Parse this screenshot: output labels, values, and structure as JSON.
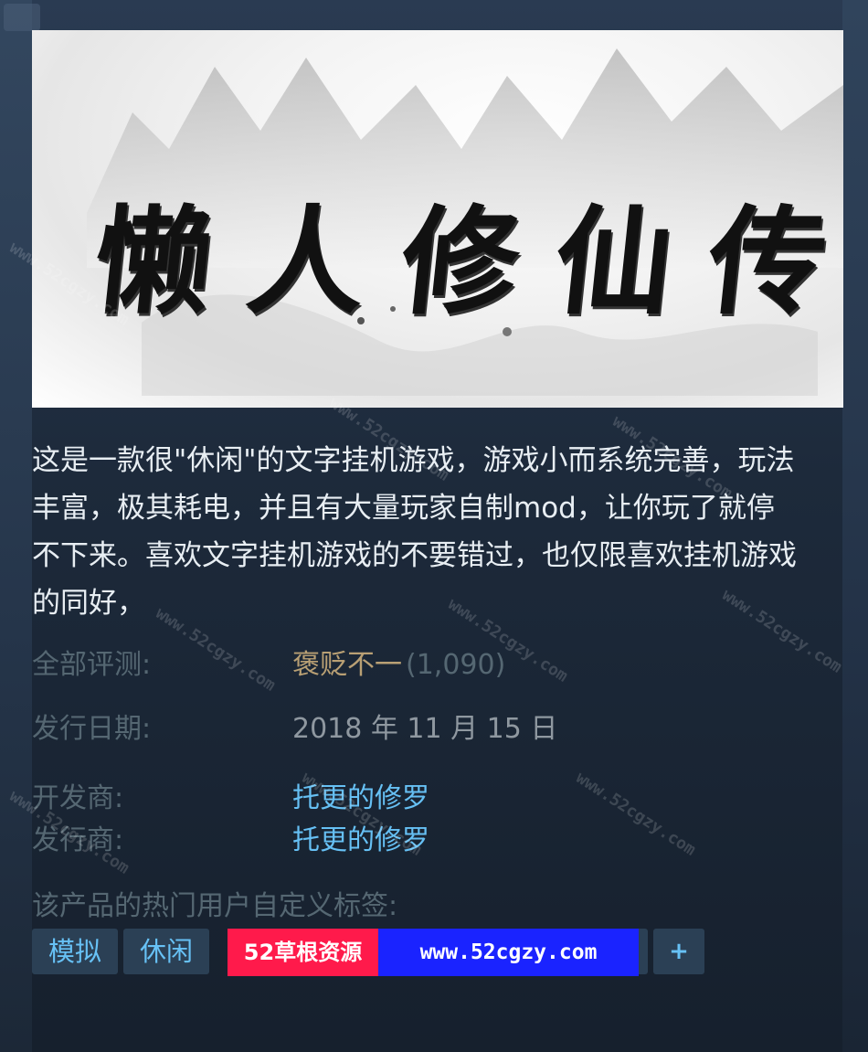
{
  "header": {
    "game_title_chars": [
      "懒",
      "人",
      "修",
      "仙",
      "传"
    ]
  },
  "description": "这是一款很\"休闲\"的文字挂机游戏，游戏小而系统完善，玩法丰富，极其耗电，并且有大量玩家自制mod，让你玩了就停不下来。喜欢文字挂机游戏的不要错过，也仅限喜欢挂机游戏的同好，",
  "reviews": {
    "label": "全部评测:",
    "summary": "褒贬不一",
    "count": "(1,090)"
  },
  "release": {
    "label": "发行日期:",
    "value": "2018 年 11 月 15 日"
  },
  "developer": {
    "label": "开发商:",
    "value": "托更的修罗"
  },
  "publisher": {
    "label": "发行商:",
    "value": "托更的修罗"
  },
  "tags": {
    "label": "该产品的热门用户自定义标签:",
    "items": [
      "模拟",
      "休闲"
    ],
    "plus": "+"
  },
  "promo": {
    "red": "52草根资源",
    "blue": "www.52cgzy.com"
  },
  "watermark": "www.52cgzy.com",
  "colors": {
    "link": "#66c0f4",
    "review_mixed": "#b9a074",
    "label": "#556772",
    "tag_bg": "#2b4055",
    "promo_red": "#ff1a4b",
    "promo_blue": "#1a23ff"
  }
}
